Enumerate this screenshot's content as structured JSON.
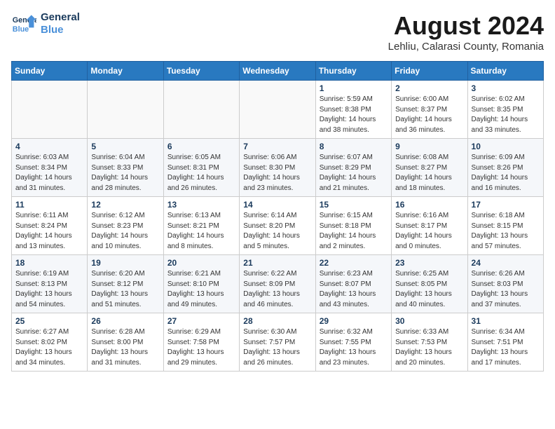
{
  "header": {
    "logo_line1": "General",
    "logo_line2": "Blue",
    "month_year": "August 2024",
    "location": "Lehliu, Calarasi County, Romania"
  },
  "weekdays": [
    "Sunday",
    "Monday",
    "Tuesday",
    "Wednesday",
    "Thursday",
    "Friday",
    "Saturday"
  ],
  "weeks": [
    [
      {
        "day": "",
        "details": ""
      },
      {
        "day": "",
        "details": ""
      },
      {
        "day": "",
        "details": ""
      },
      {
        "day": "",
        "details": ""
      },
      {
        "day": "1",
        "details": "Sunrise: 5:59 AM\nSunset: 8:38 PM\nDaylight: 14 hours\nand 38 minutes."
      },
      {
        "day": "2",
        "details": "Sunrise: 6:00 AM\nSunset: 8:37 PM\nDaylight: 14 hours\nand 36 minutes."
      },
      {
        "day": "3",
        "details": "Sunrise: 6:02 AM\nSunset: 8:35 PM\nDaylight: 14 hours\nand 33 minutes."
      }
    ],
    [
      {
        "day": "4",
        "details": "Sunrise: 6:03 AM\nSunset: 8:34 PM\nDaylight: 14 hours\nand 31 minutes."
      },
      {
        "day": "5",
        "details": "Sunrise: 6:04 AM\nSunset: 8:33 PM\nDaylight: 14 hours\nand 28 minutes."
      },
      {
        "day": "6",
        "details": "Sunrise: 6:05 AM\nSunset: 8:31 PM\nDaylight: 14 hours\nand 26 minutes."
      },
      {
        "day": "7",
        "details": "Sunrise: 6:06 AM\nSunset: 8:30 PM\nDaylight: 14 hours\nand 23 minutes."
      },
      {
        "day": "8",
        "details": "Sunrise: 6:07 AM\nSunset: 8:29 PM\nDaylight: 14 hours\nand 21 minutes."
      },
      {
        "day": "9",
        "details": "Sunrise: 6:08 AM\nSunset: 8:27 PM\nDaylight: 14 hours\nand 18 minutes."
      },
      {
        "day": "10",
        "details": "Sunrise: 6:09 AM\nSunset: 8:26 PM\nDaylight: 14 hours\nand 16 minutes."
      }
    ],
    [
      {
        "day": "11",
        "details": "Sunrise: 6:11 AM\nSunset: 8:24 PM\nDaylight: 14 hours\nand 13 minutes."
      },
      {
        "day": "12",
        "details": "Sunrise: 6:12 AM\nSunset: 8:23 PM\nDaylight: 14 hours\nand 10 minutes."
      },
      {
        "day": "13",
        "details": "Sunrise: 6:13 AM\nSunset: 8:21 PM\nDaylight: 14 hours\nand 8 minutes."
      },
      {
        "day": "14",
        "details": "Sunrise: 6:14 AM\nSunset: 8:20 PM\nDaylight: 14 hours\nand 5 minutes."
      },
      {
        "day": "15",
        "details": "Sunrise: 6:15 AM\nSunset: 8:18 PM\nDaylight: 14 hours\nand 2 minutes."
      },
      {
        "day": "16",
        "details": "Sunrise: 6:16 AM\nSunset: 8:17 PM\nDaylight: 14 hours\nand 0 minutes."
      },
      {
        "day": "17",
        "details": "Sunrise: 6:18 AM\nSunset: 8:15 PM\nDaylight: 13 hours\nand 57 minutes."
      }
    ],
    [
      {
        "day": "18",
        "details": "Sunrise: 6:19 AM\nSunset: 8:13 PM\nDaylight: 13 hours\nand 54 minutes."
      },
      {
        "day": "19",
        "details": "Sunrise: 6:20 AM\nSunset: 8:12 PM\nDaylight: 13 hours\nand 51 minutes."
      },
      {
        "day": "20",
        "details": "Sunrise: 6:21 AM\nSunset: 8:10 PM\nDaylight: 13 hours\nand 49 minutes."
      },
      {
        "day": "21",
        "details": "Sunrise: 6:22 AM\nSunset: 8:09 PM\nDaylight: 13 hours\nand 46 minutes."
      },
      {
        "day": "22",
        "details": "Sunrise: 6:23 AM\nSunset: 8:07 PM\nDaylight: 13 hours\nand 43 minutes."
      },
      {
        "day": "23",
        "details": "Sunrise: 6:25 AM\nSunset: 8:05 PM\nDaylight: 13 hours\nand 40 minutes."
      },
      {
        "day": "24",
        "details": "Sunrise: 6:26 AM\nSunset: 8:03 PM\nDaylight: 13 hours\nand 37 minutes."
      }
    ],
    [
      {
        "day": "25",
        "details": "Sunrise: 6:27 AM\nSunset: 8:02 PM\nDaylight: 13 hours\nand 34 minutes."
      },
      {
        "day": "26",
        "details": "Sunrise: 6:28 AM\nSunset: 8:00 PM\nDaylight: 13 hours\nand 31 minutes."
      },
      {
        "day": "27",
        "details": "Sunrise: 6:29 AM\nSunset: 7:58 PM\nDaylight: 13 hours\nand 29 minutes."
      },
      {
        "day": "28",
        "details": "Sunrise: 6:30 AM\nSunset: 7:57 PM\nDaylight: 13 hours\nand 26 minutes."
      },
      {
        "day": "29",
        "details": "Sunrise: 6:32 AM\nSunset: 7:55 PM\nDaylight: 13 hours\nand 23 minutes."
      },
      {
        "day": "30",
        "details": "Sunrise: 6:33 AM\nSunset: 7:53 PM\nDaylight: 13 hours\nand 20 minutes."
      },
      {
        "day": "31",
        "details": "Sunrise: 6:34 AM\nSunset: 7:51 PM\nDaylight: 13 hours\nand 17 minutes."
      }
    ]
  ]
}
